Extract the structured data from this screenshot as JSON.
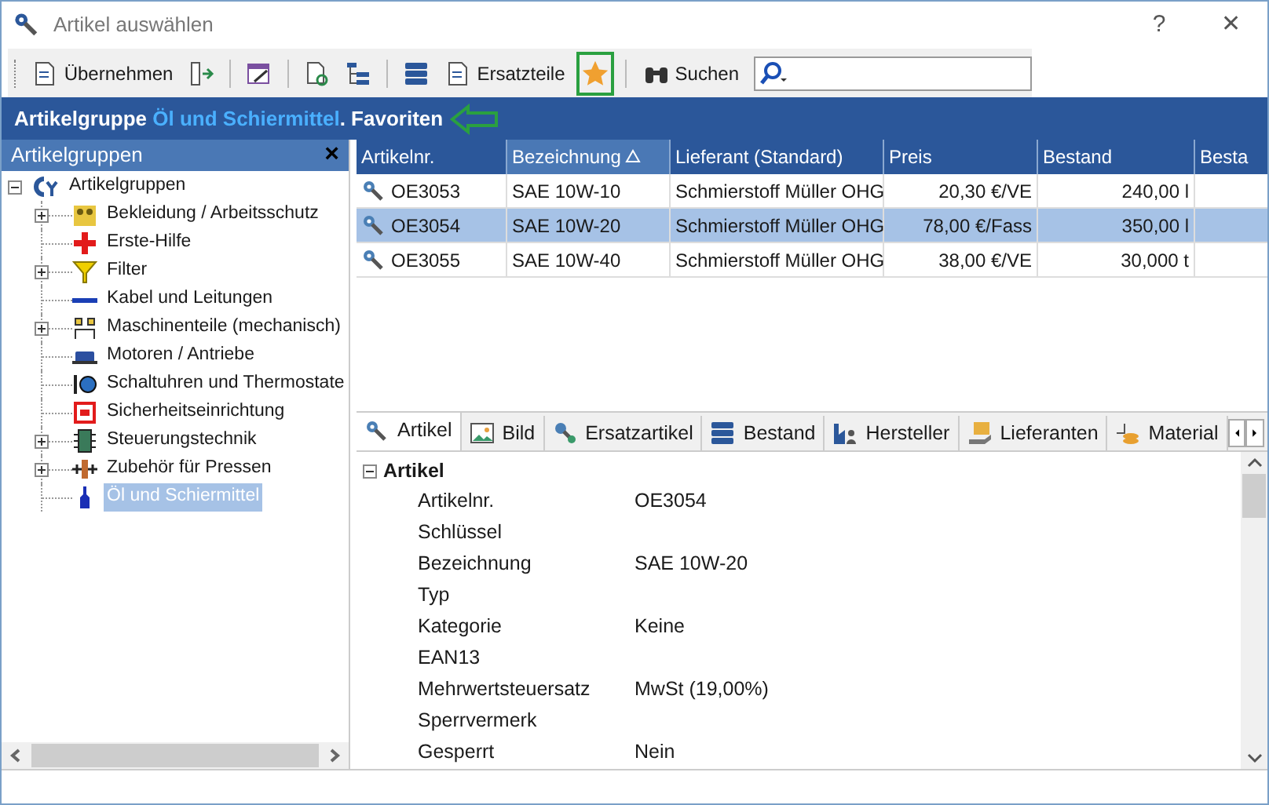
{
  "window": {
    "title": "Artikel auswählen",
    "buttons": [
      "?",
      "✕"
    ]
  },
  "toolbar": {
    "items": [
      {
        "kind": "button",
        "label": "Übernehmen",
        "selected": false
      },
      {
        "kind": "icon",
        "selected": false
      },
      {
        "kind": "separator"
      },
      {
        "kind": "icon",
        "selected": false
      },
      {
        "kind": "separator"
      },
      {
        "kind": "icon",
        "selected": false
      },
      {
        "kind": "icon",
        "selected": false
      },
      {
        "kind": "separator"
      },
      {
        "kind": "icon",
        "selected": false
      },
      {
        "kind": "button",
        "label": "Ersatzteile",
        "selected": false
      },
      {
        "kind": "star",
        "selected": true
      },
      {
        "kind": "separator"
      },
      {
        "kind": "button",
        "label": "Suchen",
        "selected": false
      }
    ]
  },
  "banner": {
    "prefix": "Artikelgruppe",
    "group": "Öl und Schiermittel",
    "suffix": ". Favoriten"
  },
  "sidebar": {
    "title": "Artikelgruppen",
    "close": "×",
    "tree": {
      "label": "Artikelgruppen",
      "expanded": true,
      "selected": false,
      "children": [
        {
          "label": "Bekleidung / Arbeitsschutz",
          "kind": "folder",
          "selected": false
        },
        {
          "label": "Erste-Hilfe",
          "kind": "leaf",
          "selected": false
        },
        {
          "label": "Filter",
          "kind": "folder",
          "selected": false
        },
        {
          "label": "Kabel und Leitungen",
          "kind": "leaf",
          "selected": false
        },
        {
          "label": "Maschinenteile (mechanisch)",
          "kind": "folder",
          "selected": false
        },
        {
          "label": "Motoren / Antriebe",
          "kind": "leaf",
          "selected": false
        },
        {
          "label": "Schaltuhren und Thermostate",
          "kind": "leaf",
          "selected": false
        },
        {
          "label": "Sicherheitseinrichtung",
          "kind": "leaf",
          "selected": false
        },
        {
          "label": "Steuerungstechnik",
          "kind": "folder",
          "selected": false
        },
        {
          "label": "Zubehör für Pressen",
          "kind": "folder",
          "selected": false
        },
        {
          "label": "Öl und Schiermittel",
          "kind": "leaf",
          "selected": true
        }
      ]
    }
  },
  "table": {
    "columns": [
      {
        "label": "Artikelnr.",
        "sorted": false
      },
      {
        "label": "Bezeichnung",
        "sorted": true
      },
      {
        "label": "Lieferant (Standard)",
        "sorted": false
      },
      {
        "label": "Preis",
        "sorted": false
      },
      {
        "label": "Bestand",
        "sorted": false
      },
      {
        "label": "Besta",
        "sorted": false
      }
    ],
    "rows": [
      {
        "selected": false,
        "cells": [
          "OE3053",
          "SAE 10W-10",
          "Schmierstoff Müller OHG",
          "20,30 €/VE",
          "240,00 l"
        ]
      },
      {
        "selected": true,
        "cells": [
          "OE3054",
          "SAE 10W-20",
          "Schmierstoff Müller OHG",
          "78,00 €/Fass",
          "350,00 l"
        ]
      },
      {
        "selected": false,
        "cells": [
          "OE3055",
          "SAE 10W-40",
          "Schmierstoff Müller OHG",
          "38,00 €/VE",
          "30,000 t"
        ]
      }
    ]
  },
  "tabs": [
    {
      "label": "Artikel",
      "selected": true
    },
    {
      "label": "Bild",
      "selected": false
    },
    {
      "label": "Ersatzartikel",
      "selected": false
    },
    {
      "label": "Bestand",
      "selected": false
    },
    {
      "label": "Hersteller",
      "selected": false
    },
    {
      "label": "Lieferanten",
      "selected": false
    },
    {
      "label": "Material",
      "selected": false
    }
  ],
  "details": {
    "section": "Artikel",
    "expanded": true,
    "fields": [
      {
        "label": "Artikelnr.",
        "value": "OE3054"
      },
      {
        "label": "Schlüssel"
      },
      {
        "label": "Bezeichnung",
        "value": "SAE 10W-20"
      },
      {
        "label": "Typ"
      },
      {
        "label": "Kategorie",
        "value": "Keine"
      },
      {
        "label": "EAN13"
      },
      {
        "label": "Mehrwertsteuersatz",
        "value": "MwSt (19,00%)"
      },
      {
        "label": "Sperrvermerk"
      },
      {
        "label": "Gesperrt",
        "value": "Nein"
      }
    ]
  }
}
